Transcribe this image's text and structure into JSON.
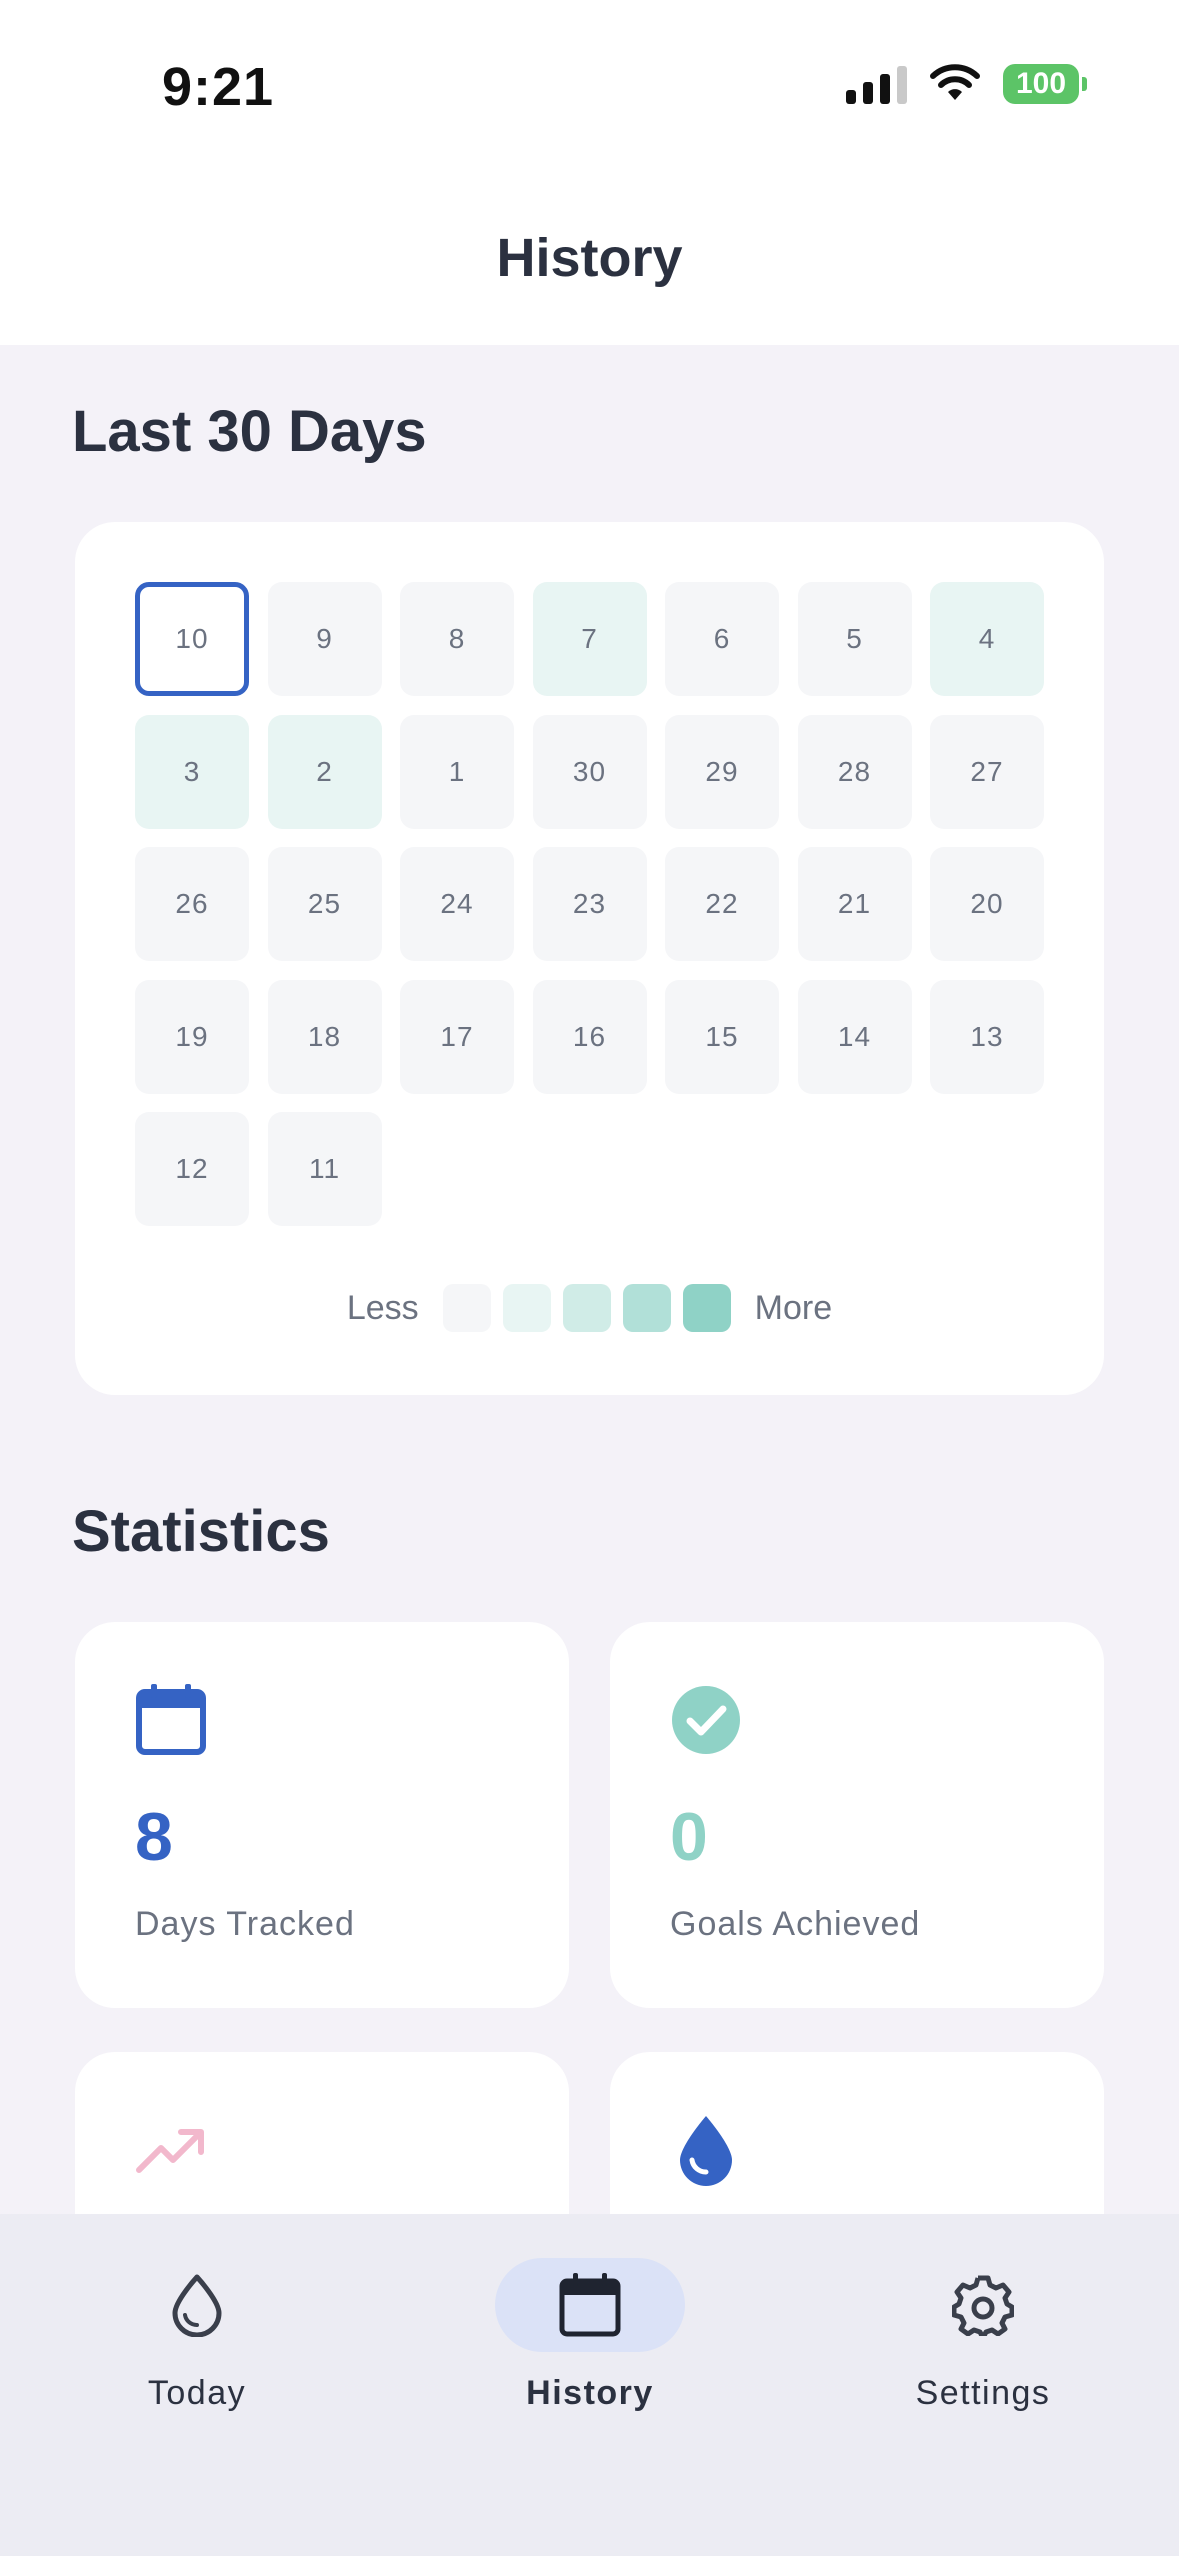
{
  "status_bar": {
    "time": "9:21",
    "battery": "100"
  },
  "header": {
    "title": "History"
  },
  "calendar": {
    "title": "Last 30 Days",
    "days": [
      {
        "label": "10",
        "level": 0,
        "today": true
      },
      {
        "label": "9",
        "level": 0
      },
      {
        "label": "8",
        "level": 0
      },
      {
        "label": "7",
        "level": 1
      },
      {
        "label": "6",
        "level": 0
      },
      {
        "label": "5",
        "level": 0
      },
      {
        "label": "4",
        "level": 1
      },
      {
        "label": "3",
        "level": 1
      },
      {
        "label": "2",
        "level": 1
      },
      {
        "label": "1",
        "level": 0
      },
      {
        "label": "30",
        "level": 0
      },
      {
        "label": "29",
        "level": 0
      },
      {
        "label": "28",
        "level": 0
      },
      {
        "label": "27",
        "level": 0
      },
      {
        "label": "26",
        "level": 0
      },
      {
        "label": "25",
        "level": 0
      },
      {
        "label": "24",
        "level": 0
      },
      {
        "label": "23",
        "level": 0
      },
      {
        "label": "22",
        "level": 0
      },
      {
        "label": "21",
        "level": 0
      },
      {
        "label": "20",
        "level": 0
      },
      {
        "label": "19",
        "level": 0
      },
      {
        "label": "18",
        "level": 0
      },
      {
        "label": "17",
        "level": 0
      },
      {
        "label": "16",
        "level": 0
      },
      {
        "label": "15",
        "level": 0
      },
      {
        "label": "14",
        "level": 0
      },
      {
        "label": "13",
        "level": 0
      },
      {
        "label": "12",
        "level": 0
      },
      {
        "label": "11",
        "level": 0
      }
    ],
    "legend": {
      "less": "Less",
      "more": "More",
      "colors": [
        "#f5f6f8",
        "#e8f5f3",
        "#d0ece7",
        "#b1e0d8",
        "#8fd2c6"
      ]
    }
  },
  "statistics": {
    "title": "Statistics",
    "cards": [
      {
        "icon": "calendar-icon",
        "value": "8",
        "label": "Days Tracked",
        "color": "#3563c4"
      },
      {
        "icon": "check-circle-icon",
        "value": "0",
        "label": "Goals Achieved",
        "color": "#8fd2c6"
      },
      {
        "icon": "trending-up-icon",
        "color": "#f2b8cc"
      },
      {
        "icon": "water-drop-icon",
        "color": "#3563c4"
      }
    ]
  },
  "tab_bar": {
    "tabs": [
      {
        "label": "Today",
        "icon": "water-drop-outline-icon",
        "active": false
      },
      {
        "label": "History",
        "icon": "calendar-icon",
        "active": true
      },
      {
        "label": "Settings",
        "icon": "gear-icon",
        "active": false
      }
    ]
  },
  "colors": {
    "accent": "#3563c4",
    "teal": "#8fd2c6",
    "pink": "#f2b8cc",
    "background": "#f4f2f8"
  }
}
